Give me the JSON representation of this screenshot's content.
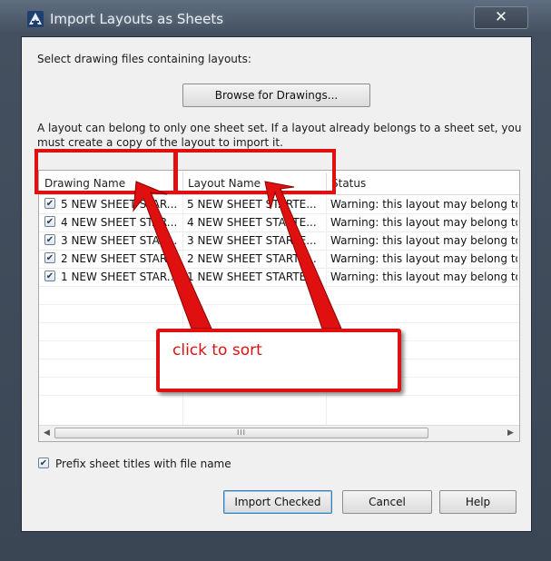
{
  "window": {
    "title": "Import Layouts as Sheets",
    "close_label": "✕",
    "app_icon": "autocad-icon"
  },
  "dialog": {
    "select_label": "Select drawing files containing layouts:",
    "browse_button": "Browse for Drawings...",
    "info_line1": "A layout can belong to only one sheet set. If a layout already belongs to a sheet set, you",
    "info_line2": "must create a copy of the layout to import it.",
    "prefix_checkbox": {
      "label": "Prefix sheet titles with file name",
      "checked": true
    },
    "buttons": {
      "import": "Import Checked",
      "cancel": "Cancel",
      "help": "Help"
    }
  },
  "table": {
    "columns": [
      "Drawing Name",
      "Layout Name",
      "Status"
    ],
    "rows": [
      {
        "checked": true,
        "drawing": "5 NEW SHEET STAR...",
        "layout": "5 NEW SHEET STARTE...",
        "status": "Warning: this layout may belong to"
      },
      {
        "checked": true,
        "drawing": "4 NEW SHEET STAR...",
        "layout": "4 NEW SHEET STARTE...",
        "status": "Warning: this layout may belong to"
      },
      {
        "checked": true,
        "drawing": "3 NEW SHEET STAR...",
        "layout": "3 NEW SHEET STARTE...",
        "status": "Warning: this layout may belong to"
      },
      {
        "checked": true,
        "drawing": "2 NEW SHEET STAR...",
        "layout": "2 NEW SHEET STARTE...",
        "status": "Warning: this layout may belong to"
      },
      {
        "checked": true,
        "drawing": "1 NEW SHEET STAR...",
        "layout": "1 NEW SHEET STARTE...",
        "status": "Warning: this layout may belong to"
      }
    ],
    "scroll_left": "◀",
    "scroll_right": "▶",
    "scroll_grip": "III"
  },
  "annotation": {
    "callout_text": "click to sort",
    "color": "#e01010"
  }
}
